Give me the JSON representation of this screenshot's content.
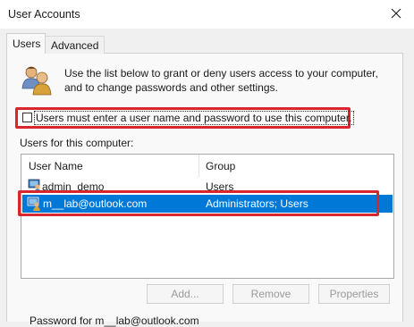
{
  "window": {
    "title": "User Accounts"
  },
  "tabs": [
    {
      "label": "Users",
      "active": true
    },
    {
      "label": "Advanced",
      "active": false
    }
  ],
  "intro_text": "Use the list below to grant or deny users access to your computer, and to change passwords and other settings.",
  "checkbox": {
    "label": "Users must enter a user name and password to use this computer.",
    "checked": false
  },
  "users_section": {
    "label": "Users for this computer:",
    "columns": [
      "User Name",
      "Group"
    ],
    "rows": [
      {
        "name": "admin_demo",
        "group": "Users",
        "selected": false
      },
      {
        "name": "m__lab@outlook.com",
        "group": "Administrators; Users",
        "selected": true
      }
    ]
  },
  "buttons": {
    "add": "Add...",
    "remove": "Remove",
    "properties": "Properties"
  },
  "bottom_text": "Password for m__lab@outlook.com",
  "colors": {
    "selection": "#0078d7",
    "highlight": "#d7262e",
    "background": "#f0f0f0"
  },
  "icons": [
    "close-icon",
    "users-icon",
    "user-icon"
  ]
}
